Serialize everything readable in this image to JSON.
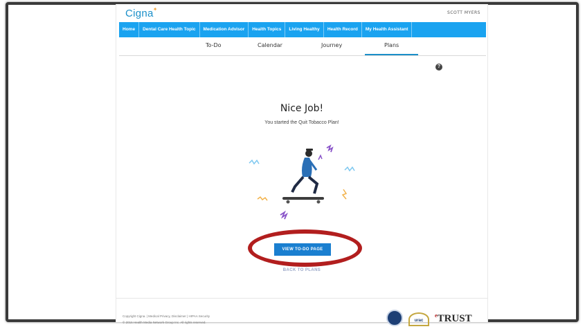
{
  "brand": {
    "name": "Cigna"
  },
  "header": {
    "user_name": "SCOTT MYERS"
  },
  "nav": {
    "items": [
      "Home",
      "Dental Care Health Topic",
      "Medication Advisor",
      "Health Topics",
      "Living Healthy",
      "Health Record",
      "My Health Assistant"
    ]
  },
  "tabs": [
    "To-Do",
    "Calendar",
    "Journey",
    "Plans"
  ],
  "active_tab": "Plans",
  "main": {
    "heading": "Nice Job!",
    "message": "You started the Quit Tobacco Plan!",
    "cta_label": "VIEW TO-DO PAGE",
    "secondary_label": "BACK TO PLANS"
  },
  "footer": {
    "copyright_1": "Copyright Cigna. | Medical Privacy, Disclaimer | HIPAA Security",
    "copyright_2": "© 2016 Health Media Network Group Inc. All rights reserved.",
    "badge_urac": "urac",
    "badge_trust": "TRUST"
  },
  "colors": {
    "brand_blue": "#1a8fc9",
    "nav_blue": "#1aa3f0",
    "cta_blue": "#1a7fd0",
    "annotation_red": "#b21e1e"
  },
  "icons": {
    "help": "question-circle-icon",
    "illustration": "skateboarder-illustration"
  }
}
